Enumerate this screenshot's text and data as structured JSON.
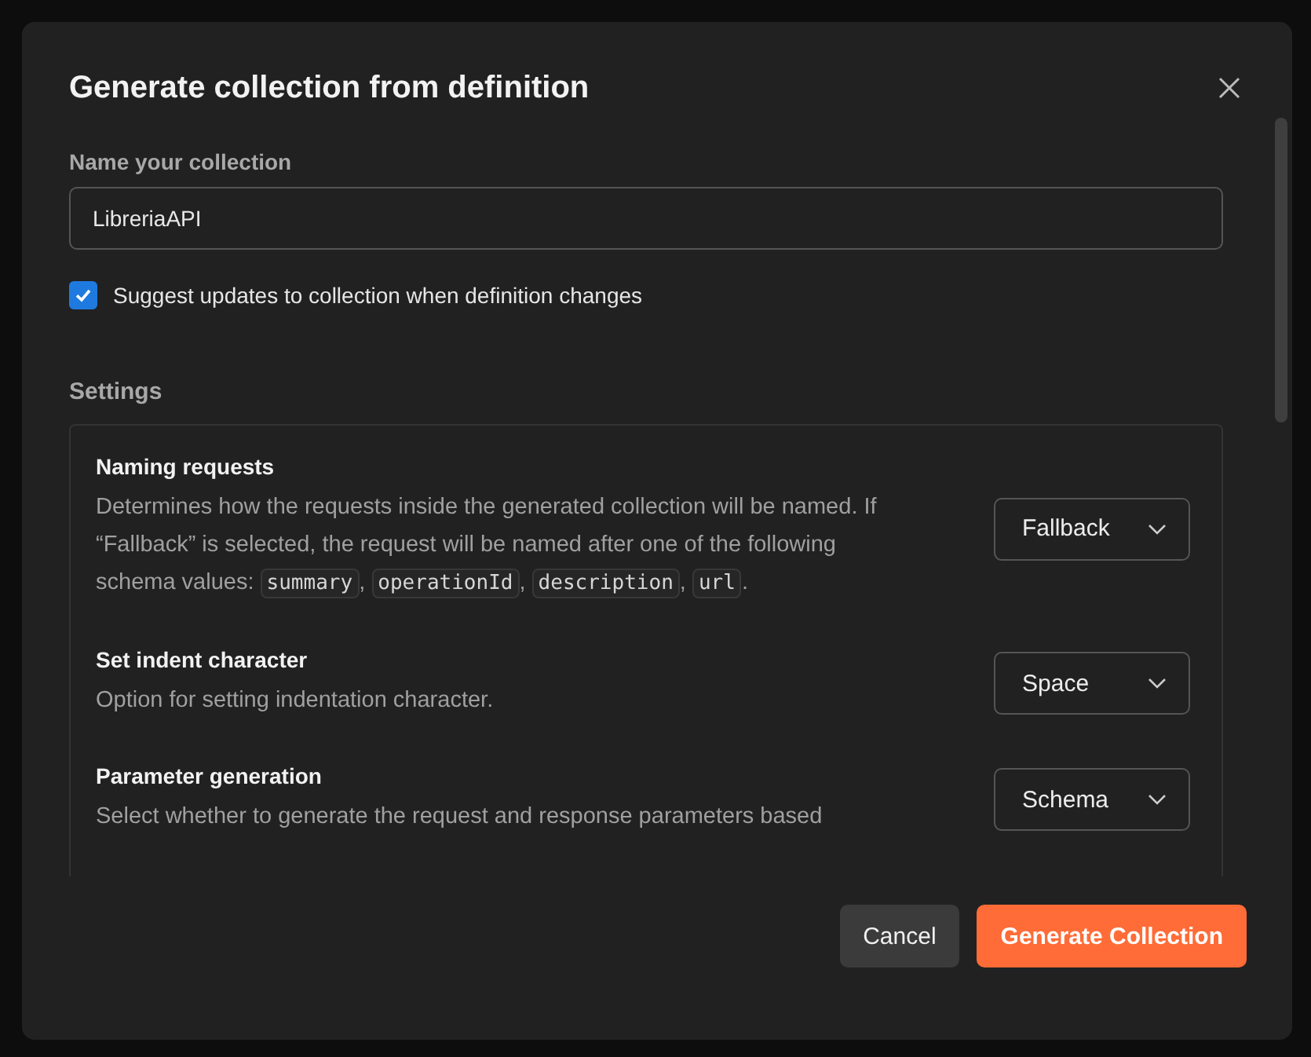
{
  "dialog": {
    "title": "Generate collection from definition",
    "name_field": {
      "label": "Name your collection",
      "value": "LibreriaAPI"
    },
    "suggest_updates": {
      "label": "Suggest updates to collection when definition changes",
      "checked": true
    },
    "settings_label": "Settings",
    "settings": [
      {
        "title": "Naming requests",
        "description": [
          {
            "kind": "text",
            "text": "Determines how the requests inside the generated collection will be named. If “Fallback” is selected, the request will be named after one of the following schema values: "
          },
          {
            "kind": "code",
            "text": "summary"
          },
          {
            "kind": "text",
            "text": ", "
          },
          {
            "kind": "code",
            "text": "operationId"
          },
          {
            "kind": "text",
            "text": ", "
          },
          {
            "kind": "code",
            "text": "description"
          },
          {
            "kind": "text",
            "text": ", "
          },
          {
            "kind": "code",
            "text": "url"
          },
          {
            "kind": "text",
            "text": "."
          }
        ],
        "value": "Fallback"
      },
      {
        "title": "Set indent character",
        "description": [
          {
            "kind": "text",
            "text": "Option for setting indentation character."
          }
        ],
        "value": "Space"
      },
      {
        "title": "Parameter generation",
        "description": [
          {
            "kind": "text",
            "text": "Select whether to generate the request and response parameters based"
          }
        ],
        "value": "Schema"
      }
    ],
    "buttons": [
      {
        "label": "Cancel",
        "kind": "secondary"
      },
      {
        "label": "Generate Collection",
        "kind": "primary"
      }
    ]
  }
}
